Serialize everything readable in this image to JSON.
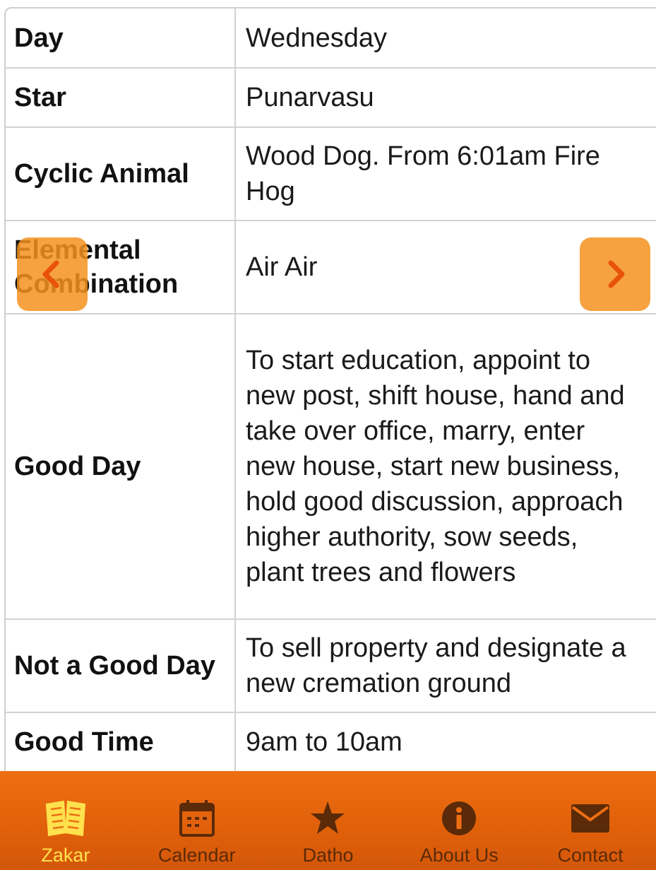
{
  "rows": [
    {
      "label": "Day",
      "value": "Wednesday"
    },
    {
      "label": "Star",
      "value": "Punarvasu"
    },
    {
      "label": "Cyclic Animal",
      "value": "Wood Dog. From 6:01am Fire Hog"
    },
    {
      "label": "Elemental Combination",
      "value": "Air Air"
    },
    {
      "label": "Good Day",
      "value": "To start education, appoint to new post, shift house, hand and take over office, marry, enter new house, start new business, hold good discussion, approach higher authority, sow seeds, plant trees and flowers"
    },
    {
      "label": "Not a Good Day",
      "value": "To sell property and designate a new cremation ground"
    },
    {
      "label": "Good Time",
      "value": "9am to 10am"
    }
  ],
  "nav": {
    "items": [
      {
        "label": "Zakar",
        "icon": "book-icon",
        "active": true
      },
      {
        "label": "Calendar",
        "icon": "calendar-icon",
        "active": false
      },
      {
        "label": "Datho",
        "icon": "star-icon",
        "active": false
      },
      {
        "label": "About Us",
        "icon": "info-icon",
        "active": false
      },
      {
        "label": "Contact",
        "icon": "envelope-icon",
        "active": false
      }
    ]
  },
  "colors": {
    "accent": "#ee6e12",
    "arrow_bg": "#f4921e",
    "arrow_glyph": "#e8520a",
    "active_nav": "#ffe14d",
    "inactive_nav": "#5b2a08"
  }
}
